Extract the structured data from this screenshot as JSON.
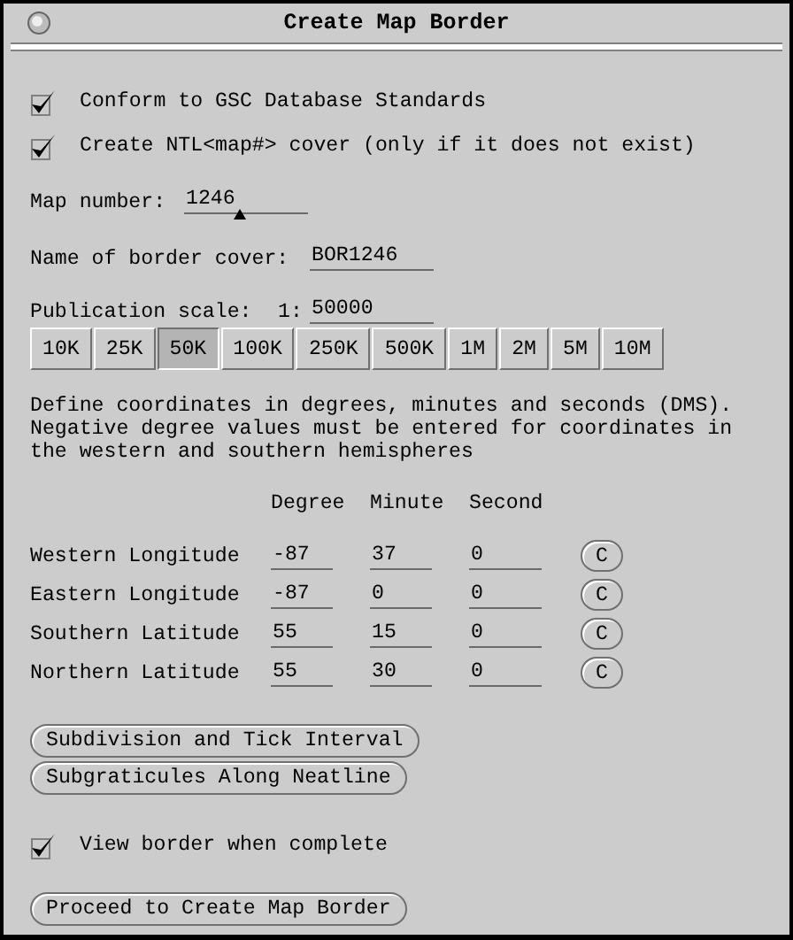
{
  "window": {
    "title": "Create Map Border"
  },
  "options": [
    {
      "label": "Conform to GSC Database Standards",
      "checked": true
    },
    {
      "label": "Create NTL<map#> cover (only if it does not exist)",
      "checked": true
    }
  ],
  "map_number": {
    "label": "Map number:",
    "value": "1246"
  },
  "border_cover": {
    "label": "Name of border cover:",
    "value": "BOR1246"
  },
  "publication_scale": {
    "label": "Publication scale:",
    "prefix": "1:",
    "value": "50000"
  },
  "scale_buttons": [
    {
      "label": "10K",
      "selected": false
    },
    {
      "label": "25K",
      "selected": false
    },
    {
      "label": "50K",
      "selected": true
    },
    {
      "label": "100K",
      "selected": false
    },
    {
      "label": "250K",
      "selected": false
    },
    {
      "label": "500K",
      "selected": false
    },
    {
      "label": "1M",
      "selected": false
    },
    {
      "label": "2M",
      "selected": false
    },
    {
      "label": "5M",
      "selected": false
    },
    {
      "label": "10M",
      "selected": false
    }
  ],
  "instructions": "Define coordinates in degrees, minutes and seconds (DMS).\nNegative degree values must be entered for coordinates in\nthe western and southern hemispheres",
  "coordinates": {
    "columns": [
      "Degree",
      "Minute",
      "Second"
    ],
    "rows": [
      {
        "label": "Western Longitude",
        "degree": "-87",
        "minute": "37",
        "second": "0",
        "button": "C"
      },
      {
        "label": "Eastern Longitude",
        "degree": "-87",
        "minute": "0",
        "second": "0",
        "button": "C"
      },
      {
        "label": "Southern Latitude",
        "degree": "55",
        "minute": "15",
        "second": "0",
        "button": "C"
      },
      {
        "label": "Northern Latitude",
        "degree": "55",
        "minute": "30",
        "second": "0",
        "button": "C"
      }
    ]
  },
  "buttons": [
    "Subdivision and Tick Interval",
    "Subgraticules Along Neatline"
  ],
  "view_border": {
    "label": "View border when complete",
    "checked": true
  },
  "proceed_button": "Proceed to Create Map Border"
}
